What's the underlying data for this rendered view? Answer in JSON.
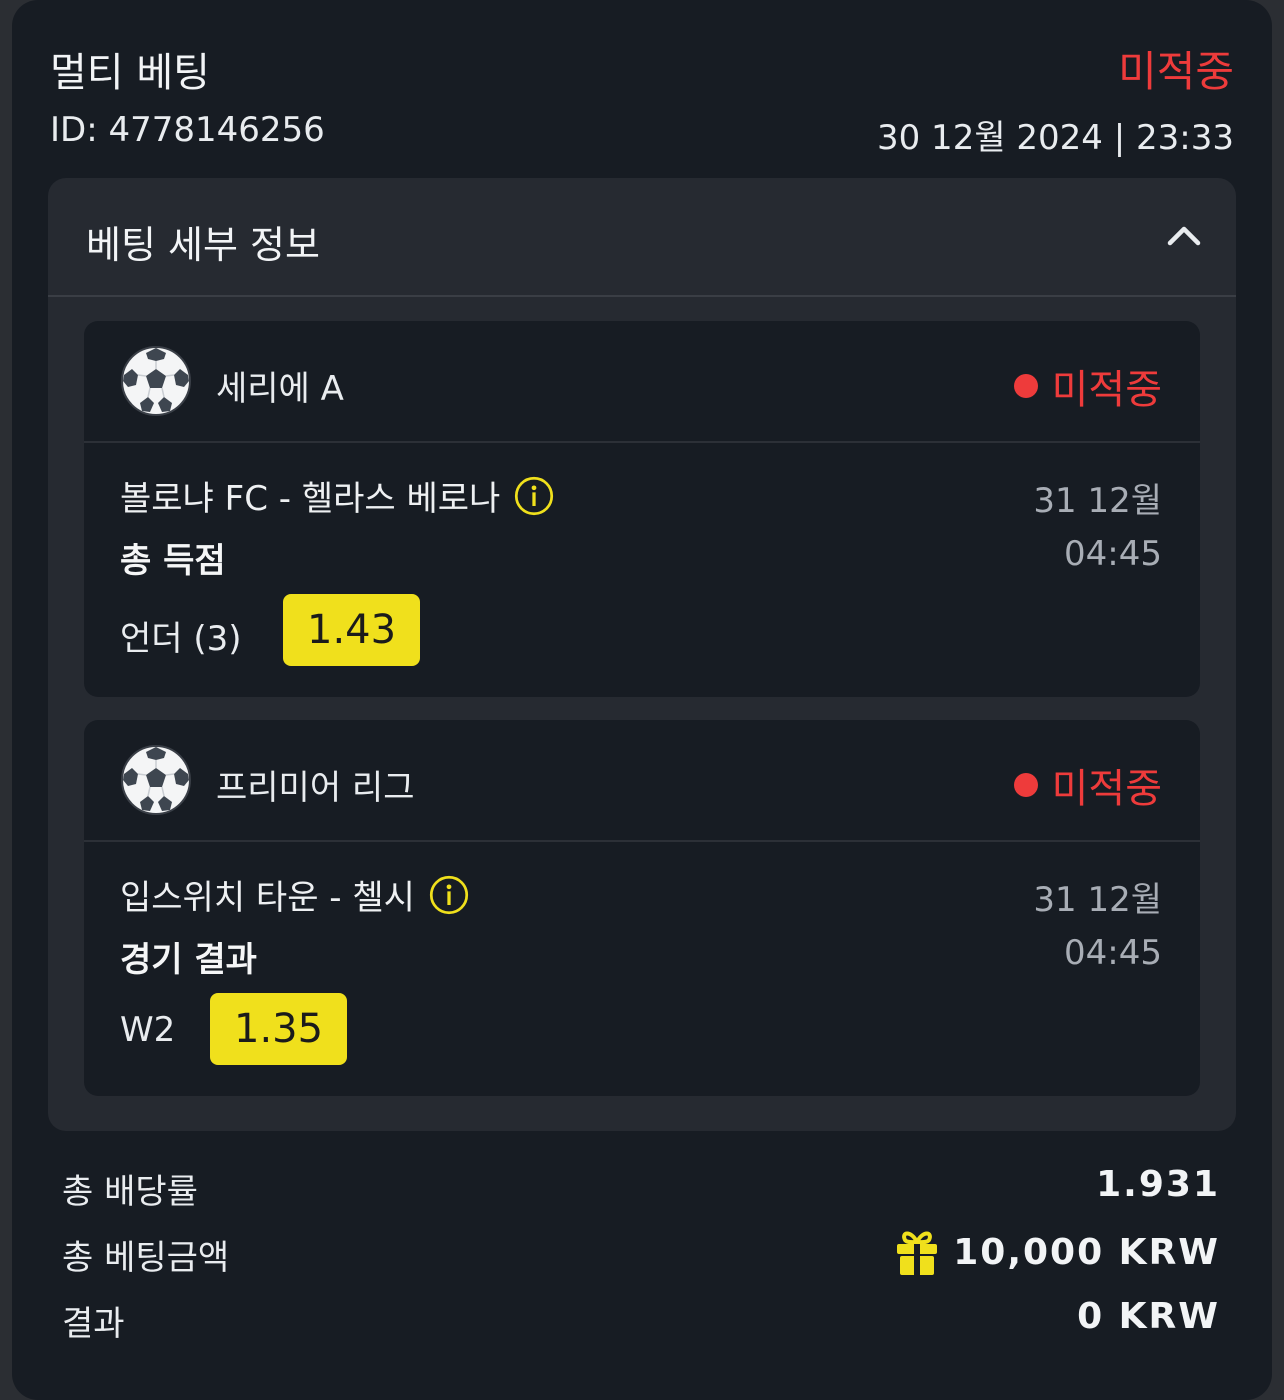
{
  "header": {
    "title": "멀티 베팅",
    "status": "미적중",
    "id_text": "ID: 4778146256",
    "datetime": "30 12월 2024 | 23:33"
  },
  "details": {
    "title": "베팅 세부 정보",
    "toggle_icon": "chevron-up-icon",
    "events": [
      {
        "league": "세리에 A",
        "sport_icon": "soccer-ball-icon",
        "status": "미적중",
        "match": "볼로냐 FC - 헬라스 베로나",
        "market": "총 득점",
        "date": "31 12월",
        "time": "04:45",
        "pick": "언더 (3)",
        "odds": "1.43"
      },
      {
        "league": "프리미어 리그",
        "sport_icon": "soccer-ball-icon",
        "status": "미적중",
        "match": "입스위치 타운 - 첼시",
        "market": "경기 결과",
        "date": "31 12월",
        "time": "04:45",
        "pick": "W2",
        "odds": "1.35"
      }
    ]
  },
  "summary": {
    "total_odds_label": "총 배당률",
    "total_odds_value": "1.931",
    "total_stake_label": "총 베팅금액",
    "total_stake_value": "10,000 KRW",
    "stake_icon": "gift-icon",
    "result_label": "결과",
    "result_value": "0 KRW"
  },
  "colors": {
    "lost": "#ee3b3b",
    "odds_badge": "#f0e01c",
    "info_icon": "#f0e01c",
    "card_bg": "#171c23",
    "panel_bg": "#262a31"
  }
}
